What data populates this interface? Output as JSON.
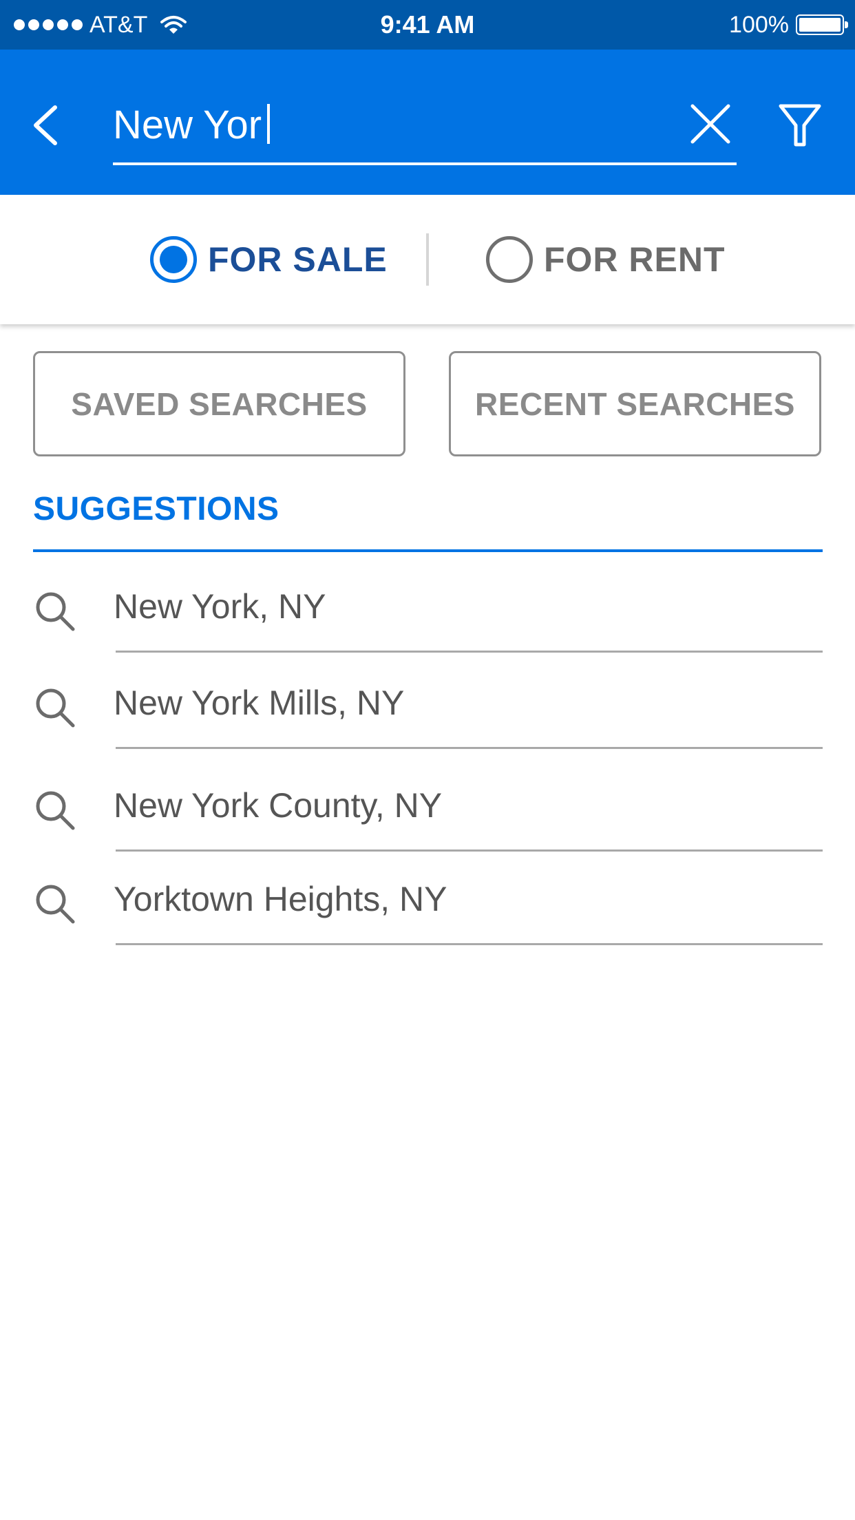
{
  "status_bar": {
    "carrier": "AT&T",
    "time": "9:41 AM",
    "battery": "100%"
  },
  "header": {
    "search_value": "New Yor",
    "back_icon": "chevron-left-icon",
    "clear_icon": "close-icon",
    "filter_icon": "filter-icon"
  },
  "listing_type": {
    "options": [
      {
        "label": "FOR SALE",
        "selected": true
      },
      {
        "label": "FOR RENT",
        "selected": false
      }
    ]
  },
  "search_buttons": {
    "saved": "SAVED SEARCHES",
    "recent": "RECENT SEARCHES"
  },
  "suggestions": {
    "heading": "SUGGESTIONS",
    "items": [
      {
        "label": "New York, NY"
      },
      {
        "label": "New York Mills, NY"
      },
      {
        "label": "New York County, NY"
      },
      {
        "label": "Yorktown Heights, NY"
      }
    ]
  },
  "colors": {
    "accent": "#0173e3",
    "status_bar": "#0058a8",
    "selected_label": "#1b4e97",
    "muted_text": "#8a8a8a"
  }
}
